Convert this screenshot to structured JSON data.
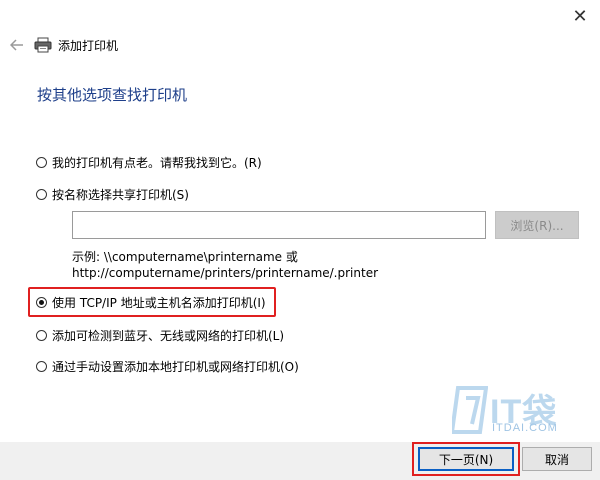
{
  "window": {
    "title": "添加打印机",
    "close_glyph": "✕"
  },
  "page": {
    "heading": "按其他选项查找打印机"
  },
  "options": [
    {
      "label": "我的打印机有点老。请帮我找到它。(R)",
      "checked": false
    },
    {
      "label": "按名称选择共享打印机(S)",
      "checked": false
    },
    {
      "label": "使用 TCP/IP 地址或主机名添加打印机(I)",
      "checked": true
    },
    {
      "label": "添加可检测到蓝牙、无线或网络的打印机(L)",
      "checked": false
    },
    {
      "label": "通过手动设置添加本地打印机或网络打印机(O)",
      "checked": false
    }
  ],
  "shared": {
    "input_value": "",
    "browse_label": "浏览(R)...",
    "example_line1": "示例: \\\\computername\\printername 或",
    "example_line2": "http://computername/printers/printername/.printer"
  },
  "watermark": {
    "brand": "IT袋",
    "domain": "ITDAI.COM"
  },
  "footer": {
    "next_label": "下一页(N)",
    "cancel_label": "取消"
  },
  "colors": {
    "heading": "#1e3f8a",
    "highlight": "#e02020",
    "primary_border": "#0a5fc4"
  },
  "icons": [
    "close-icon",
    "back-arrow-icon",
    "printer-icon",
    "itdai-logo-icon"
  ]
}
